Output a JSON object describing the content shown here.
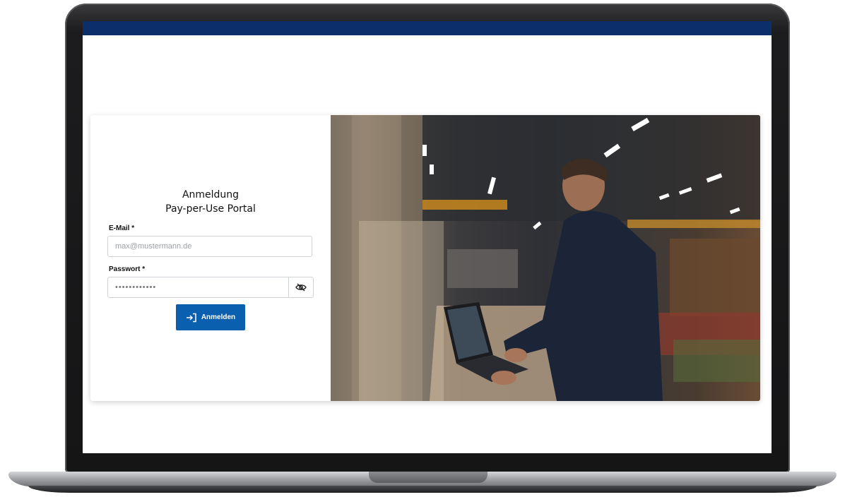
{
  "login": {
    "title_line1": "Anmeldung",
    "title_line2": "Pay-per-Use Portal",
    "email_label": "E-Mail *",
    "email_placeholder": "max@mustermann.de",
    "password_label": "Passwort *",
    "password_value": "••••••••••••",
    "submit_label": "Anmelden",
    "toggle_icon": "eye-slash-icon",
    "submit_icon": "login-arrow-icon"
  },
  "colors": {
    "header_bar": "#0b2f6b",
    "primary_button": "#0a5fae"
  }
}
